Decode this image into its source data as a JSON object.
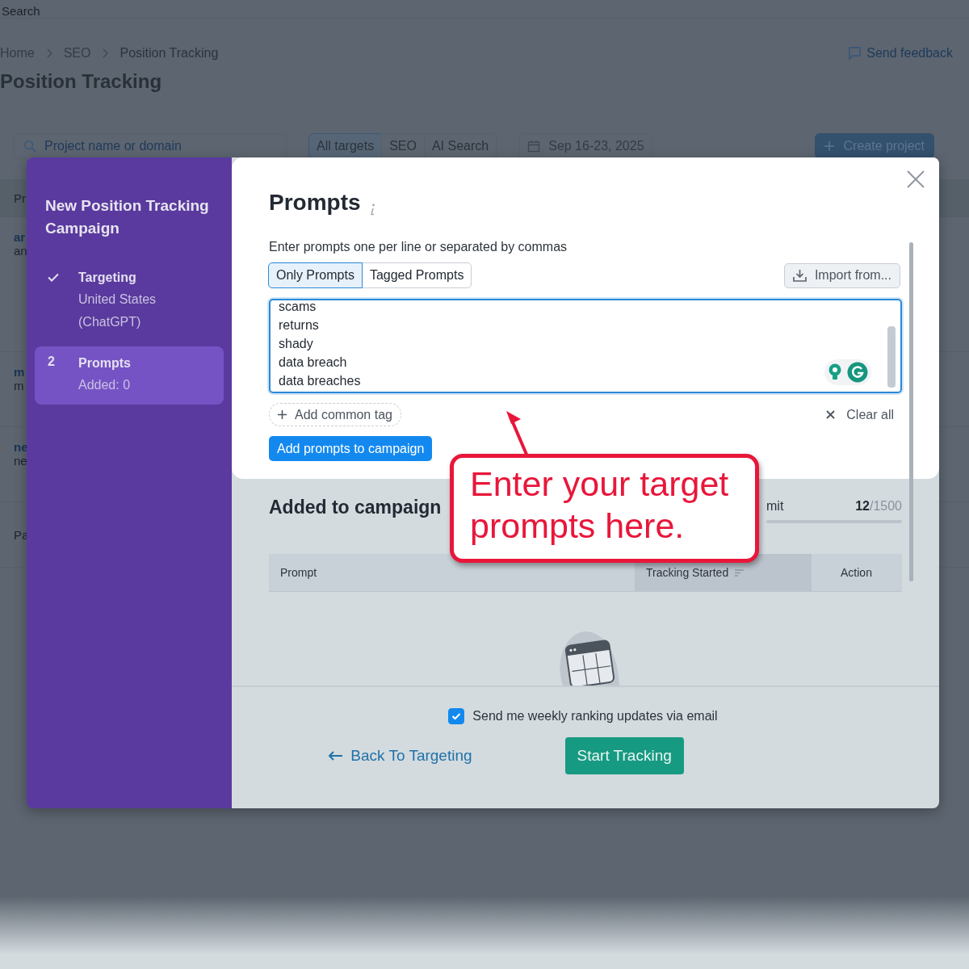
{
  "search": {
    "placeholder": "Search"
  },
  "breadcrumbs": [
    "Home",
    "SEO",
    "Position Tracking"
  ],
  "feedback_link": "Send feedback",
  "page_title": "Position Tracking",
  "filters": {
    "search": {
      "placeholder": "Project name or domain"
    },
    "segments": [
      {
        "label": "All targets",
        "selected": true
      },
      {
        "label": "SEO",
        "selected": false
      },
      {
        "label": "AI Search",
        "selected": false
      }
    ],
    "date": "Sep 16-23, 2025",
    "create_button": "Create project"
  },
  "project_rows": [
    {
      "kind": "header",
      "lines": [
        "Pr"
      ]
    },
    {
      "kind": "project",
      "lines": [
        "ar",
        "an"
      ]
    },
    {
      "kind": "project",
      "lines": [
        "m",
        "m"
      ]
    },
    {
      "kind": "project",
      "lines": [
        "ne",
        "ne"
      ]
    },
    {
      "kind": "footer",
      "lines": [
        "Pa"
      ]
    }
  ],
  "modal": {
    "sidebar": {
      "title": "New Position Tracking Campaign",
      "steps": [
        {
          "title": "Targeting",
          "details": [
            "United States",
            "(ChatGPT)"
          ],
          "done": true,
          "selected": false
        },
        {
          "number": "2",
          "title": "Prompts",
          "details": [
            "Added: 0"
          ],
          "done": false,
          "selected": true
        }
      ]
    },
    "prompts": {
      "title": "Prompts",
      "instruction": "Enter prompts one per line or separated by commas",
      "tabs": [
        {
          "label": "Only Prompts",
          "selected": true
        },
        {
          "label": "Tagged Prompts",
          "selected": false
        }
      ],
      "import_button": "Import from...",
      "textarea": {
        "lines": [
          "scams",
          "returns",
          "shady",
          "data breach",
          "data breaches"
        ]
      },
      "add_tag_button": "Add common tag",
      "clear_button": "Clear all",
      "submit_button": "Add prompts to campaign"
    },
    "added": {
      "title": "Added to campaign",
      "limit_label": "mit",
      "count": "**12**/1500"
    },
    "table": {
      "columns": [
        {
          "label": "Prompt",
          "sorted": false
        },
        {
          "label": "Tracking Started",
          "sorted": true
        },
        {
          "label": "Action",
          "sorted": false
        }
      ]
    },
    "footer": {
      "email_updates": {
        "label": "Send me weekly ranking updates via email",
        "checked": true
      },
      "back_link": "Back To Targeting",
      "start_button": "Start Tracking"
    }
  },
  "callout": {
    "text": "Enter your target prompts here."
  }
}
